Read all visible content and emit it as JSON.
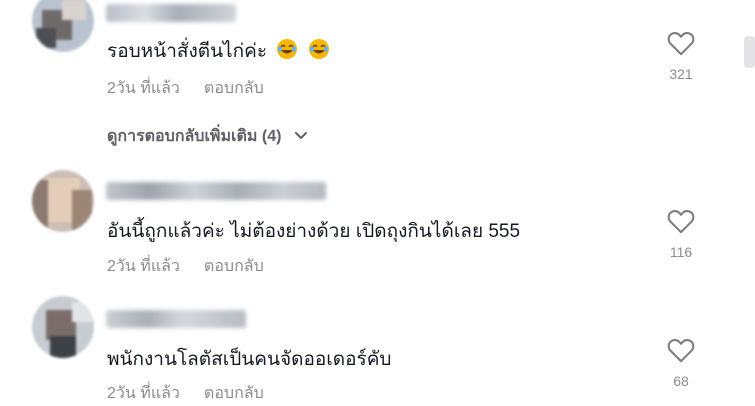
{
  "comments": [
    {
      "text": "รอบหน้าสั่งตีนไก่ค่ะ",
      "emojis": [
        "laughing-face",
        "laughing-face"
      ],
      "time": "2วัน ที่แล้ว",
      "reply_label": "ตอบกลับ",
      "likes": "321"
    },
    {
      "text": "อันนี้ถูกแล้วค่ะ ไม่ต้องย่างด้วย เปิดถุงกินได้เลย 555",
      "time": "2วัน ที่แล้ว",
      "reply_label": "ตอบกลับ",
      "likes": "116"
    },
    {
      "text": "พนักงานโลตัสเป็นคนจัดออเดอร์คับ",
      "time": "2วัน ที่แล้ว",
      "reply_label": "ตอบกลับ",
      "likes": "68"
    }
  ],
  "more_replies_label": "ดูการตอบกลับเพิ่มเติม (4)",
  "colors": {
    "text": "#161823",
    "muted": "#8a8b91",
    "accent_emoji": "#f7b500"
  }
}
